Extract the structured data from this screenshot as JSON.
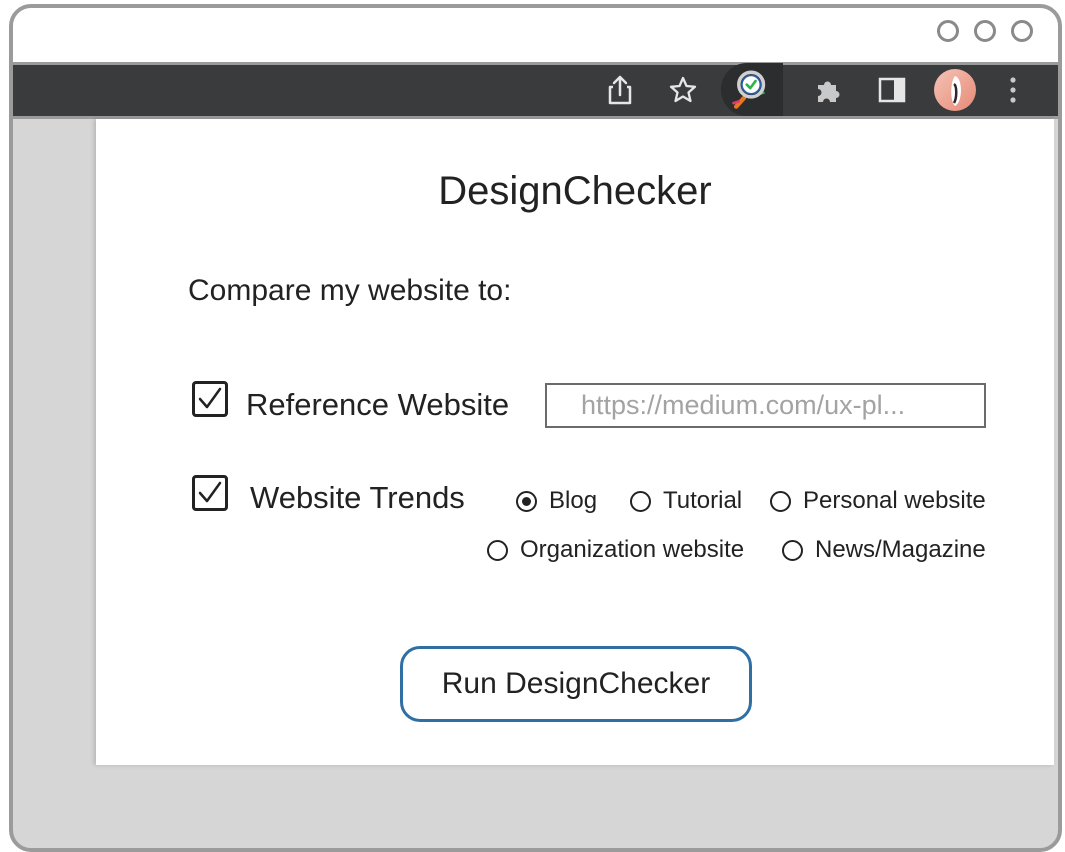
{
  "app": {
    "title": "DesignChecker",
    "compare_label": "Compare my website to:"
  },
  "reference": {
    "label": "Reference Website",
    "checked": true,
    "url_value": "https://medium.com/ux-pl..."
  },
  "trends": {
    "label": "Website Trends",
    "checked": true,
    "options": [
      {
        "label": "Blog",
        "selected": true
      },
      {
        "label": "Tutorial",
        "selected": false
      },
      {
        "label": "Personal website",
        "selected": false
      },
      {
        "label": "Organization website",
        "selected": false
      },
      {
        "label": "News/Magazine",
        "selected": false
      }
    ]
  },
  "actions": {
    "run_label": "Run DesignChecker"
  },
  "colors": {
    "button_border": "#2f6fa3",
    "toolbar": "#3a3b3d",
    "window_border": "#9b9b9b"
  },
  "toolbar_icons": [
    "share-icon",
    "star-icon",
    "designchecker-extension-icon",
    "puzzle-extension-icon",
    "sidepanel-icon",
    "avatar",
    "kebab-menu-icon"
  ]
}
